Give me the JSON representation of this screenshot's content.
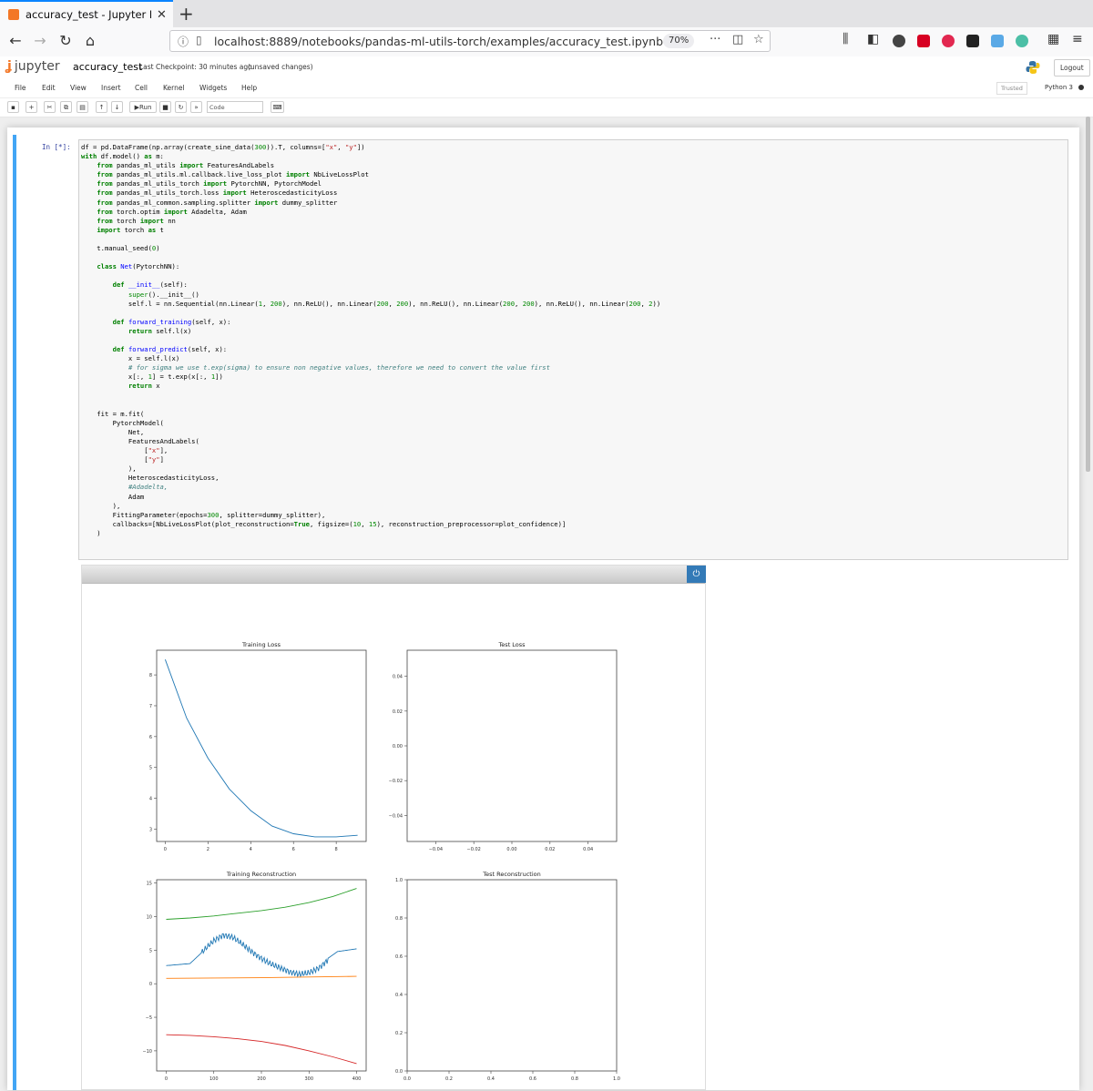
{
  "browser": {
    "tab_title": "accuracy_test - Jupyter No",
    "url": "localhost:8889/notebooks/pandas-ml-utils-torch/examples/accuracy_test.ipynb",
    "zoom": "70%"
  },
  "jupyter": {
    "logo_text": "jupyter",
    "notebook_name": "accuracy_test",
    "checkpoint": "Last Checkpoint: 30 minutes ago",
    "unsaved": "(unsaved changes)",
    "logout_label": "Logout",
    "menu": [
      "File",
      "Edit",
      "View",
      "Insert",
      "Cell",
      "Kernel",
      "Widgets",
      "Help"
    ],
    "trusted_label": "Trusted",
    "kernel_name": "Python 3",
    "run_label": "Run",
    "cell_type": "Code"
  },
  "cell": {
    "prompt": "In [*]:"
  },
  "colors": {
    "cell_selected": "#42a5f5",
    "tab_accent": "#0a84ff",
    "jupyter_orange": "#f37726",
    "widget_button": "#337ab7"
  },
  "chart_data": [
    {
      "type": "line",
      "title": "Training Loss",
      "x": [
        0,
        1,
        2,
        3,
        4,
        5,
        6,
        7,
        8,
        9
      ],
      "series": [
        {
          "values": [
            8.5,
            6.6,
            5.3,
            4.3,
            3.6,
            3.1,
            2.85,
            2.75,
            2.75,
            2.8
          ]
        }
      ],
      "xlim": [
        -0.4,
        9.4
      ],
      "ylim": [
        2.6,
        8.8
      ],
      "xticks": [
        0,
        2,
        4,
        6,
        8
      ],
      "yticks": [
        3,
        4,
        5,
        6,
        7,
        8
      ]
    },
    {
      "type": "line",
      "title": "Test Loss",
      "series": [],
      "xlim": [
        -0.055,
        0.055
      ],
      "ylim": [
        -0.055,
        0.055
      ],
      "xticks": [
        -0.04,
        -0.02,
        0.0,
        0.02,
        0.04
      ],
      "xtick_labels": [
        "−0.04",
        "−0.02",
        "0.00",
        "0.02",
        "0.04"
      ],
      "yticks": [
        -0.04,
        -0.02,
        0.0,
        0.02,
        0.04
      ],
      "ytick_labels": [
        "−0.04",
        "−0.02",
        "0.00",
        "0.02",
        "0.04"
      ]
    },
    {
      "type": "line",
      "title": "Training Reconstruction",
      "xlim": [
        -20,
        420
      ],
      "ylim": [
        -13,
        15.5
      ],
      "xticks": [
        0,
        100,
        200,
        300,
        400
      ],
      "yticks": [
        -10,
        -5,
        0,
        5,
        10,
        15
      ],
      "ytick_labels": [
        "−10",
        "−5",
        "0",
        "5",
        "10",
        "15"
      ],
      "series": [
        {
          "color": "#2ca02c",
          "x": [
            0,
            50,
            100,
            150,
            200,
            250,
            300,
            350,
            400
          ],
          "values": [
            9.6,
            9.8,
            10.1,
            10.5,
            10.9,
            11.4,
            12.1,
            13.0,
            14.2
          ]
        },
        {
          "color": "#1f77b4",
          "noisy": true,
          "x": [
            0,
            50,
            80,
            100,
            120,
            140,
            160,
            180,
            200,
            220,
            240,
            260,
            280,
            300,
            320,
            340,
            360,
            380,
            400
          ],
          "values": [
            2.7,
            3.0,
            5.0,
            6.2,
            7.0,
            6.8,
            6.0,
            5.0,
            4.0,
            3.0,
            2.2,
            1.5,
            1.2,
            1.6,
            2.5,
            3.8,
            4.8,
            5.0,
            5.2
          ]
        },
        {
          "color": "#ff7f0e",
          "x": [
            0,
            100,
            200,
            300,
            400
          ],
          "values": [
            0.8,
            0.85,
            0.9,
            1.0,
            1.1
          ]
        },
        {
          "color": "#d62728",
          "x": [
            0,
            50,
            100,
            150,
            200,
            250,
            300,
            350,
            400
          ],
          "values": [
            -7.6,
            -7.7,
            -7.9,
            -8.2,
            -8.6,
            -9.2,
            -10.0,
            -10.9,
            -11.9
          ]
        }
      ]
    },
    {
      "type": "line",
      "title": "Test Reconstruction",
      "series": [],
      "xlim": [
        0,
        1
      ],
      "ylim": [
        0,
        1
      ],
      "xticks": [
        0.0,
        0.2,
        0.4,
        0.6,
        0.8,
        1.0
      ],
      "xtick_labels": [
        "0.0",
        "0.2",
        "0.4",
        "0.6",
        "0.8",
        "1.0"
      ],
      "yticks": [
        0.0,
        0.2,
        0.4,
        0.6,
        0.8,
        1.0
      ],
      "ytick_labels": [
        "0.0",
        "0.2",
        "0.4",
        "0.6",
        "0.8",
        "1.0"
      ]
    }
  ]
}
